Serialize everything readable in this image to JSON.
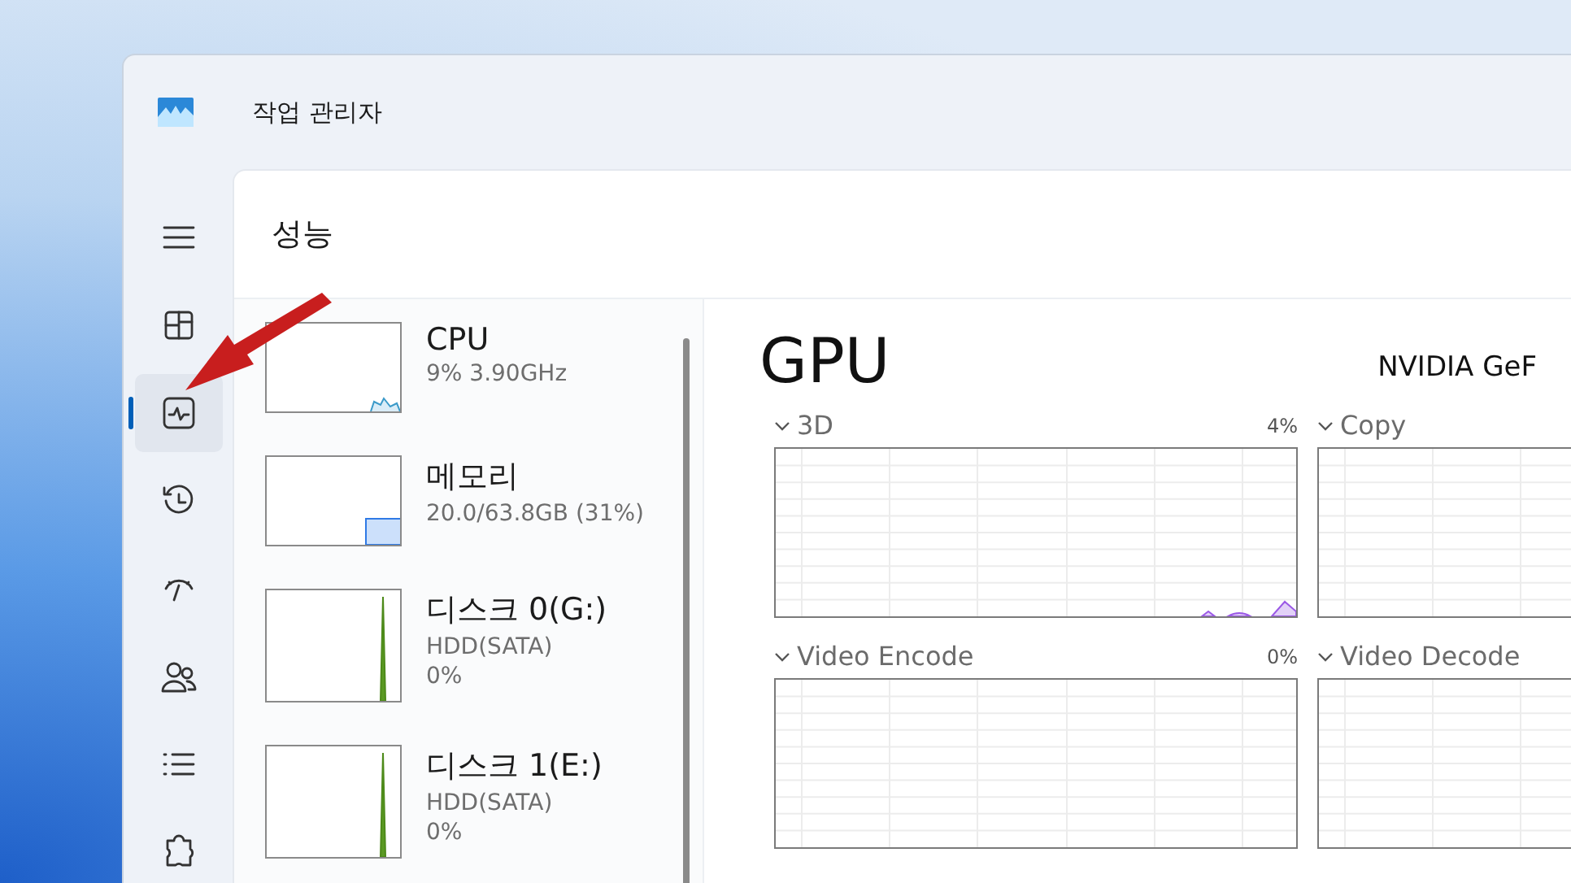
{
  "window": {
    "title": "작업 관리자"
  },
  "nav": [
    {
      "kind": "menu",
      "selected": false
    },
    {
      "kind": "processes",
      "selected": false
    },
    {
      "kind": "performance",
      "selected": true
    },
    {
      "kind": "history",
      "selected": false
    },
    {
      "kind": "startup",
      "selected": false
    },
    {
      "kind": "users",
      "selected": false
    },
    {
      "kind": "details",
      "selected": false
    },
    {
      "kind": "services",
      "selected": false
    }
  ],
  "page": {
    "title": "성능"
  },
  "devices": [
    {
      "name": "CPU",
      "kind": "line",
      "details": [
        "9% 3.90GHz"
      ]
    },
    {
      "name": "메모리",
      "kind": "fill",
      "details": [
        "20.0/63.8GB (31%)"
      ]
    },
    {
      "name": "디스크 0(G:)",
      "kind": "spike",
      "details": [
        "HDD(SATA)",
        "0%"
      ]
    },
    {
      "name": "디스크 1(E:)",
      "kind": "spike",
      "details": [
        "HDD(SATA)",
        "0%"
      ]
    }
  ],
  "gpu": {
    "title": "GPU",
    "model": "NVIDIA GeF",
    "engines": [
      {
        "name": "3D",
        "reading": "4%",
        "kind": "active"
      },
      {
        "name": "Copy",
        "kind": "idle"
      },
      {
        "name": "Video Encode",
        "reading": "0%",
        "kind": "idle"
      },
      {
        "name": "Video Decode",
        "kind": "idle"
      }
    ]
  }
}
